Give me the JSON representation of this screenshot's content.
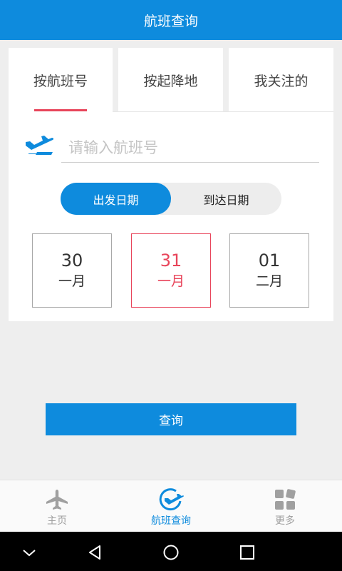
{
  "app_bar": {
    "title": "航班查询"
  },
  "tabs": [
    {
      "label": "按航班号"
    },
    {
      "label": "按起降地"
    },
    {
      "label": "我关注的"
    }
  ],
  "search": {
    "placeholder": "请输入航班号",
    "value": ""
  },
  "date_type": {
    "options": [
      {
        "label": "出发日期"
      },
      {
        "label": "到达日期"
      }
    ],
    "selected": "出发日期"
  },
  "dates": [
    {
      "day": "30",
      "month": "一月"
    },
    {
      "day": "31",
      "month": "一月"
    },
    {
      "day": "01",
      "month": "二月"
    }
  ],
  "selected_date": "31",
  "query_button": {
    "label": "查询"
  },
  "bottom_nav": [
    {
      "label": "主页",
      "icon": "airplane-icon"
    },
    {
      "label": "航班查询",
      "icon": "flight-search-icon"
    },
    {
      "label": "更多",
      "icon": "grid-icon"
    }
  ],
  "colors": {
    "primary": "#0e8bdd",
    "accent": "#e8445a",
    "background": "#eeeeee"
  }
}
